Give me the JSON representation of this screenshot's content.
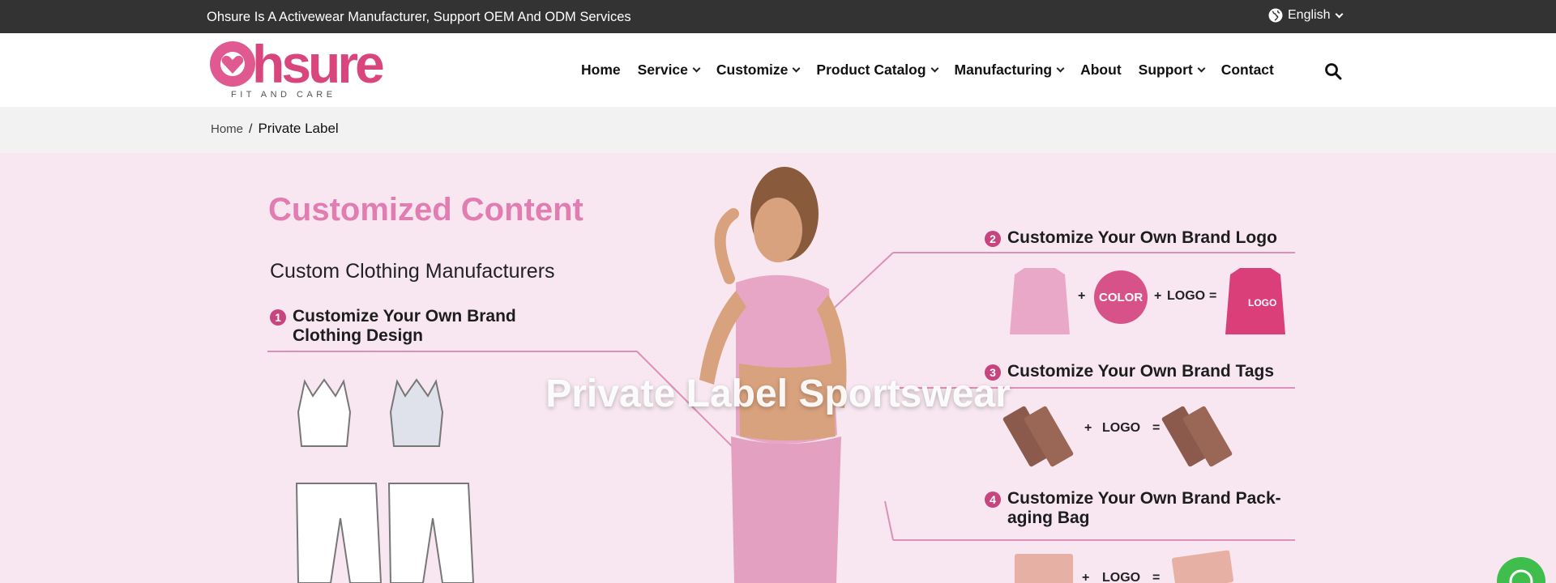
{
  "topbar": {
    "message": "Ohsure Is A Activewear Manufacturer, Support OEM And ODM Services",
    "language": "English"
  },
  "logo": {
    "wordmark": "Ohsure",
    "tagline": "FIT AND CARE"
  },
  "nav": {
    "items": [
      {
        "label": "Home"
      },
      {
        "label": "Service"
      },
      {
        "label": "Customize"
      },
      {
        "label": "Product Catalog"
      },
      {
        "label": "Manufacturing"
      },
      {
        "label": "About"
      },
      {
        "label": "Support"
      },
      {
        "label": "Contact"
      }
    ],
    "search_icon": "search-icon"
  },
  "breadcrumb": {
    "home": "Home",
    "separator": "/",
    "current": "Private Label"
  },
  "hero": {
    "title": "Private Label Sportswear",
    "heading": "Customized Content",
    "subheading": "Custom Clothing Manufacturers",
    "steps": [
      {
        "num": "1",
        "line1": "Customize Your Own Brand",
        "line2": "Clothing Design"
      },
      {
        "num": "2",
        "line1": "Customize Your Own Brand Logo",
        "line2": ""
      },
      {
        "num": "3",
        "line1": "Customize Your Own Brand Tags",
        "line2": ""
      },
      {
        "num": "4",
        "line1": "Customize Your Own Brand Pack-",
        "line2": "aging Bag"
      }
    ],
    "color_badge": "COLOR",
    "logo_word": "LOGO",
    "plus": "+",
    "equals": "="
  },
  "colors": {
    "topbar_bg": "#333333",
    "hero_bg": "#f8e7f0",
    "brand_pink": "#d9467e",
    "heading_pink": "#e27db2",
    "whatsapp_green": "#3fbd4d"
  }
}
